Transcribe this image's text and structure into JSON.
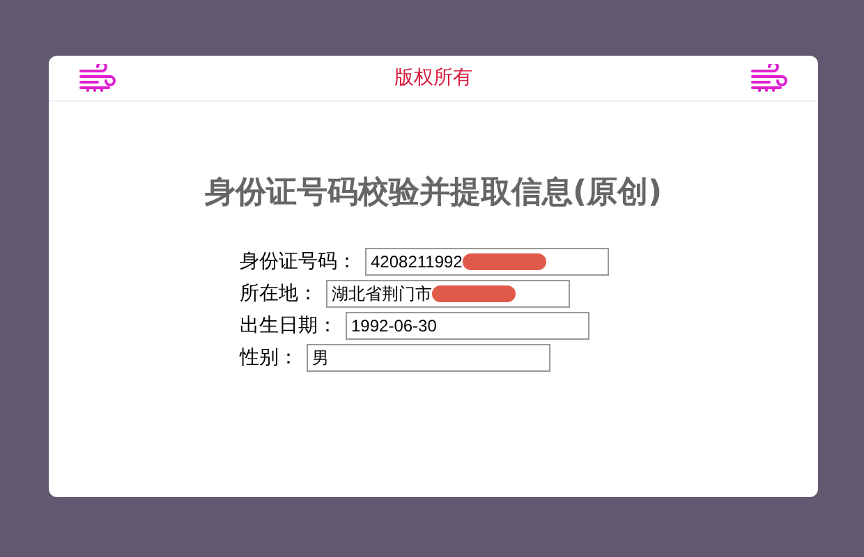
{
  "header": {
    "title": "版权所有"
  },
  "heading": "身份证号码校验并提取信息(原创)",
  "fields": [
    {
      "label": "身份证号码：",
      "value": "4208211992",
      "redacted": true
    },
    {
      "label": "所在地：",
      "value": "湖北省荆门市",
      "redacted": true
    },
    {
      "label": "出生日期：",
      "value": "1992-06-30",
      "redacted": false
    },
    {
      "label": "性别：",
      "value": "男",
      "redacted": false
    }
  ]
}
